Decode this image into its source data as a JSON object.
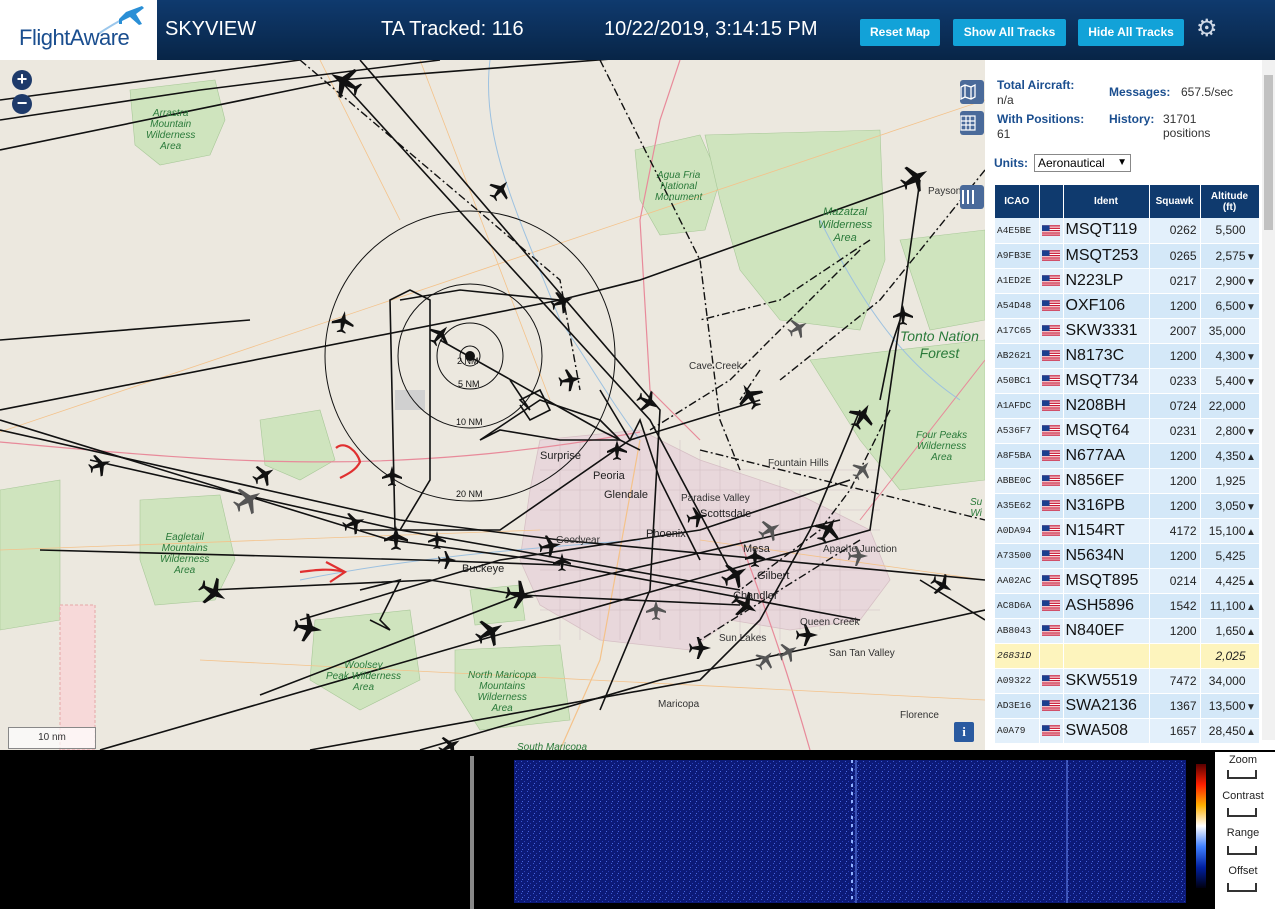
{
  "header": {
    "logo_text": "FlightAware",
    "title": "SKYVIEW",
    "tracked": "TA Tracked: 116",
    "datetime": "10/22/2019, 3:14:15 PM",
    "buttons": {
      "reset": "Reset Map",
      "show": "Show All Tracks",
      "hide": "Hide All Tracks"
    },
    "settings_icon": "gear-icon"
  },
  "map": {
    "zoom_in": "+",
    "zoom_out": "−",
    "scale": "10 nm",
    "info": "i",
    "rings": [
      "2 NM",
      "5 NM",
      "10 NM",
      "20 NM"
    ],
    "places": {
      "cave_creek": "Cave Creek",
      "surprise": "Surprise",
      "peoria": "Peoria",
      "glendale": "Glendale",
      "paradise_valley": "Paradise Valley",
      "scottsdale": "Scottsdale",
      "phoenix": "Phoenix",
      "goodyear": "Goodyear",
      "buckeye": "Buckeye",
      "mesa": "Mesa",
      "gilbert": "Gilbert",
      "chandler": "Chandler",
      "apache_junction": "Apache Junction",
      "fountain_hills": "Fountain Hills",
      "queen_creek": "Queen Creek",
      "sun_lakes": "Sun Lakes",
      "san_tan_valley": "San Tan Valley",
      "maricopa": "Maricopa",
      "florence": "Florence",
      "payson": "Payson"
    },
    "wilderness": {
      "arrastra": "Arrastra\nMountain\nWilderness\nArea",
      "agua_fria": "Agua Fria\nNational\nMonument",
      "mazatzal": "Mazatzal\nWilderness\nArea",
      "four_peaks": "Four Peaks\nWilderness\nArea",
      "eagletail": "Eagletail\nMountains\nWilderness\nArea",
      "woolsey": "Woolsey\nPeak Wilderness\nArea",
      "north_maricopa": "North Maricopa\nMountains\nWilderness\nArea",
      "south_maricopa": "South Maricopa",
      "su": "Su\nWi",
      "tonto": "Tonto Nation\nForest"
    }
  },
  "stats": {
    "total_label": "Total Aircraft:",
    "total_value": "n/a",
    "positions_label": "With Positions:",
    "positions_value": "61",
    "messages_label": "Messages:",
    "messages_value": "657.5/sec",
    "history_label": "History:",
    "history_value": "31701\npositions"
  },
  "units": {
    "label": "Units:",
    "selected": "Aeronautical"
  },
  "table": {
    "columns": [
      "ICAO",
      "",
      "Ident",
      "Squawk",
      "Altitude\n(ft)"
    ],
    "rows": [
      {
        "icao": "A4E5BE",
        "ident": "MSQT119",
        "squawk": "0262",
        "alt": "5,500",
        "trend": ""
      },
      {
        "icao": "A9FB3E",
        "ident": "MSQT253",
        "squawk": "0265",
        "alt": "2,575",
        "trend": "▼"
      },
      {
        "icao": "A1ED2E",
        "ident": "N223LP",
        "squawk": "0217",
        "alt": "2,900",
        "trend": "▼"
      },
      {
        "icao": "A54D48",
        "ident": "OXF106",
        "squawk": "1200",
        "alt": "6,500",
        "trend": "▼"
      },
      {
        "icao": "A17C65",
        "ident": "SKW3331",
        "squawk": "2007",
        "alt": "35,000",
        "trend": ""
      },
      {
        "icao": "AB2621",
        "ident": "N8173C",
        "squawk": "1200",
        "alt": "4,300",
        "trend": "▼"
      },
      {
        "icao": "A50BC1",
        "ident": "MSQT734",
        "squawk": "0233",
        "alt": "5,400",
        "trend": "▼"
      },
      {
        "icao": "A1AFDC",
        "ident": "N208BH",
        "squawk": "0724",
        "alt": "22,000",
        "trend": ""
      },
      {
        "icao": "A536F7",
        "ident": "MSQT64",
        "squawk": "0231",
        "alt": "2,800",
        "trend": "▼"
      },
      {
        "icao": "A8F5BA",
        "ident": "N677AA",
        "squawk": "1200",
        "alt": "4,350",
        "trend": "▲"
      },
      {
        "icao": "ABBE0C",
        "ident": "N856EF",
        "squawk": "1200",
        "alt": "1,925",
        "trend": ""
      },
      {
        "icao": "A35E62",
        "ident": "N316PB",
        "squawk": "1200",
        "alt": "3,050",
        "trend": "▼"
      },
      {
        "icao": "A0DA94",
        "ident": "N154RT",
        "squawk": "4172",
        "alt": "15,100",
        "trend": "▲"
      },
      {
        "icao": "A73500",
        "ident": "N5634N",
        "squawk": "1200",
        "alt": "5,425",
        "trend": ""
      },
      {
        "icao": "AA02AC",
        "ident": "MSQT895",
        "squawk": "0214",
        "alt": "4,425",
        "trend": "▲"
      },
      {
        "icao": "AC8D6A",
        "ident": "ASH5896",
        "squawk": "1542",
        "alt": "11,100",
        "trend": "▲"
      },
      {
        "icao": "AB8043",
        "ident": "N840EF",
        "squawk": "1200",
        "alt": "1,650",
        "trend": "▲"
      },
      {
        "icao": "26831D",
        "ident": "",
        "squawk": "",
        "alt": "2,025",
        "trend": "",
        "highlight": true,
        "no_flag": true
      },
      {
        "icao": "A09322",
        "ident": "SKW5519",
        "squawk": "7472",
        "alt": "34,000",
        "trend": ""
      },
      {
        "icao": "AD3E16",
        "ident": "SWA2136",
        "squawk": "1367",
        "alt": "13,500",
        "trend": "▼"
      },
      {
        "icao": "A0A79",
        "ident": "SWA508",
        "squawk": "1657",
        "alt": "28,450",
        "trend": "▲"
      }
    ]
  },
  "spectrum": {
    "controls": [
      "Zoom",
      "Contrast",
      "Range",
      "Offset"
    ]
  },
  "colors": {
    "header": "#0f3a6e",
    "button": "#12a2d8",
    "table_header": "#0f3a6e",
    "row": "#e3f0fb",
    "highlight": "#fdf4bd"
  }
}
